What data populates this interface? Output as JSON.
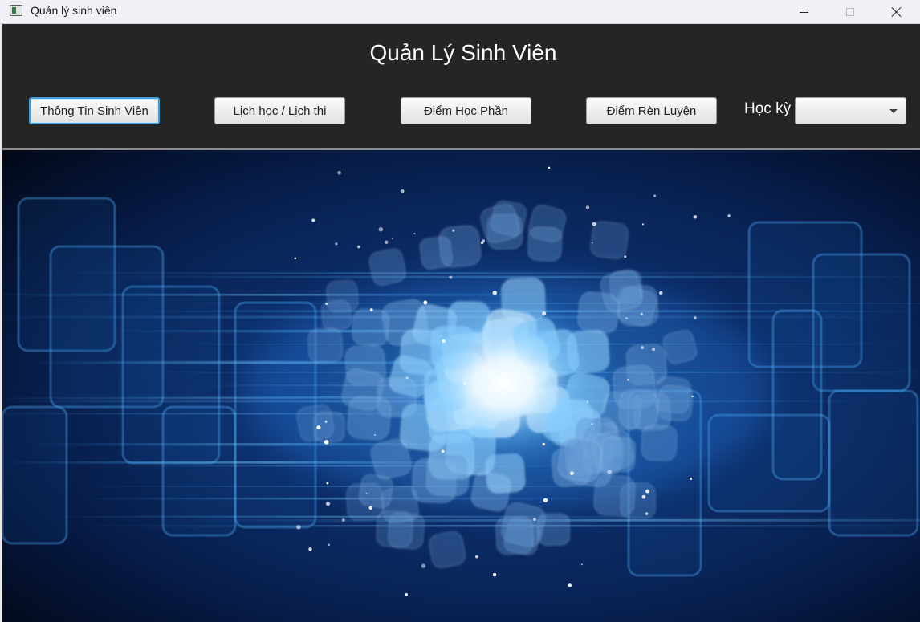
{
  "window": {
    "title": "Quản lý sinh viên",
    "icon": "app-window-icon",
    "controls": [
      "minimize-icon",
      "maximize-icon",
      "close-icon"
    ]
  },
  "header": {
    "title": "Quản Lý Sinh Viên",
    "background_color": "#252525",
    "buttons": [
      {
        "label": "Thông Tin Sinh Viên",
        "focused": true
      },
      {
        "label": "Lịch học / Lịch thi",
        "focused": false
      },
      {
        "label": "Điểm Học Phần",
        "focused": false
      },
      {
        "label": "Điểm Rèn Luyện",
        "focused": false
      }
    ],
    "semester": {
      "label": "Học kỳ",
      "selected_value": "",
      "icon": "chevron-down-icon"
    }
  },
  "colors": {
    "focus_ring": "#3d9fe0",
    "hero_dark": "#020817",
    "hero_glow": "#e8f6ff",
    "hero_accent": "#2f8fe0"
  },
  "hero_image": {
    "subject": "glowing digital globe of tiles"
  }
}
